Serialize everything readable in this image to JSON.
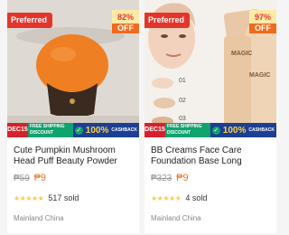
{
  "products": [
    {
      "badge": "Preferred",
      "discount_pct": "82%",
      "discount_off": "OFF",
      "promo_date": "DEC15",
      "promo_ship": "FREE SHIPPING DISCOUNT",
      "promo_cash_big": "100%",
      "promo_cash_label": "CASHBACK",
      "title": "Cute Pumpkin Mushroom Head Puff Beauty Powder Sponge W...",
      "old_price": "₱59",
      "new_price": "₱9",
      "stars": "★★★★★",
      "rating_value": 5,
      "sold": "517 sold",
      "location": "Mainland China"
    },
    {
      "badge": "Preferred",
      "discount_pct": "97%",
      "discount_off": "OFF",
      "promo_date": "DEC15",
      "promo_ship": "FREE SHIPPING DISCOUNT",
      "promo_cash_big": "100%",
      "promo_cash_label": "CASHBACK",
      "title": "BB Creams Face Care Foundation Base Long Lasting...",
      "old_price": "₱323",
      "new_price": "₱9",
      "stars": "★★★★★",
      "rating_value": 5,
      "sold": "4 sold",
      "location": "Mainland China",
      "image_text": {
        "brand": "MAGIC",
        "swatch_labels": [
          "01",
          "02",
          "03"
        ]
      }
    }
  ],
  "colors": {
    "badge_bg": "#e5352b",
    "price": "#f57224",
    "star": "#faca51",
    "discount_bg": "#ffe9a7"
  }
}
